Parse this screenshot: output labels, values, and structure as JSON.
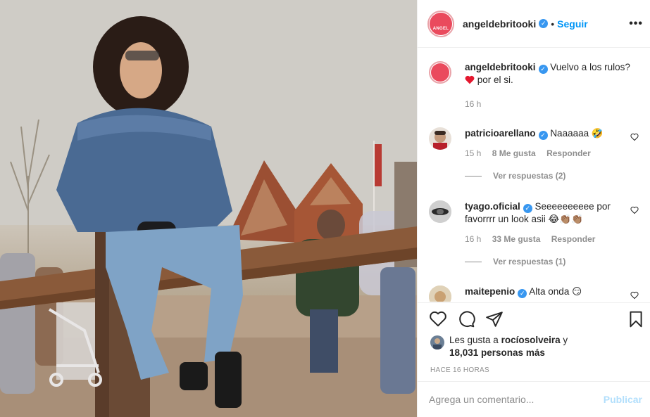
{
  "post": {
    "username": "angeldebritooki",
    "follow_label": "Seguir",
    "dot": "•",
    "more_label": "•••",
    "avatar_text": "ANGEL"
  },
  "caption": {
    "username": "angeldebritooki",
    "text": "Vuelvo a los rulos?",
    "text2": "por el si.",
    "emoji": "❤️",
    "time": "16 h"
  },
  "comments": [
    {
      "username": "patricioarellano",
      "text": "Naaaaaa 🤣",
      "time": "15 h",
      "likes": "8 Me gusta",
      "reply": "Responder",
      "view_replies": "Ver respuestas (2)"
    },
    {
      "username": "tyago.oficial",
      "text": "Seeeeeeeeee por favorrrr un look asii 😂👏🏽👏🏽",
      "time": "16 h",
      "likes": "33 Me gusta",
      "reply": "Responder",
      "view_replies": "Ver respuestas (1)"
    },
    {
      "username": "maitepenio",
      "text": "Alta onda 😏"
    }
  ],
  "likes": {
    "prefix": "Les gusta a",
    "user": "rocíosolveira",
    "conj": "y",
    "others": "18,031 personas más"
  },
  "time_ago": "HACE 16 HORAS",
  "add_comment": {
    "placeholder": "Agrega un comentario...",
    "publish_label": "Publicar"
  },
  "colors": {
    "accent": "#0095f6",
    "heart": "#ed4956",
    "avatar": "#ea4a5d"
  }
}
